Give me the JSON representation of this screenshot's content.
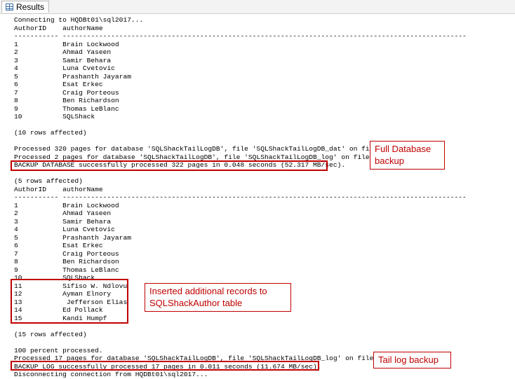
{
  "tab": {
    "label": "Results",
    "icon": "grid-icon"
  },
  "lines": [
    "Connecting to HQDBt01\\sql2017...",
    "AuthorID    authorName",
    "----------- ----------------------------------------------------------------------------------------------------",
    "1           Brain Lockwood",
    "2           Ahmad Yaseen",
    "3           Samir Behara",
    "4           Luna Cvetovic",
    "5           Prashanth Jayaram",
    "6           Esat Erkec",
    "7           Craig Porteous",
    "8           Ben Richardson",
    "9           Thomas LeBlanc",
    "10          SQLShack",
    "",
    "(10 rows affected)",
    "",
    "Processed 320 pages for database 'SQLShackTailLogDB', file 'SQLShackTailLogDB_dat' on file 1.",
    "Processed 2 pages for database 'SQLShackTailLogDB', file 'SQLShackTailLogDB_log' on file 1.",
    "BACKUP DATABASE successfully processed 322 pages in 0.048 seconds (52.317 MB/sec).",
    "",
    "(5 rows affected)",
    "AuthorID    authorName",
    "----------- ----------------------------------------------------------------------------------------------------",
    "1           Brain Lockwood",
    "2           Ahmad Yaseen",
    "3           Samir Behara",
    "4           Luna Cvetovic",
    "5           Prashanth Jayaram",
    "6           Esat Erkec",
    "7           Craig Porteous",
    "8           Ben Richardson",
    "9           Thomas LeBlanc",
    "10          SQLShack",
    "11          Sifiso W. Ndlovu",
    "12          Ayman Elnory",
    "13           Jefferson Elias",
    "14          Ed Pollack",
    "15          Kandi Humpf",
    "",
    "(15 rows affected)",
    "",
    "100 percent processed.",
    "Processed 17 pages for database 'SQLShackTailLogDB', file 'SQLShackTailLogDB_log' on file 1.",
    "BACKUP LOG successfully processed 17 pages in 0.011 seconds (11.674 MB/sec).",
    "Disconnecting connection from HQDBt01\\sql2017..."
  ],
  "callouts": {
    "full_backup": {
      "line1": "Full Database",
      "line2": "backup"
    },
    "inserted": {
      "line1": "Inserted additional records to",
      "line2": "SQLShackAuthor table"
    },
    "tail_log": {
      "line1": "Tail log backup"
    }
  },
  "colors": {
    "annotation": "#c00000"
  }
}
